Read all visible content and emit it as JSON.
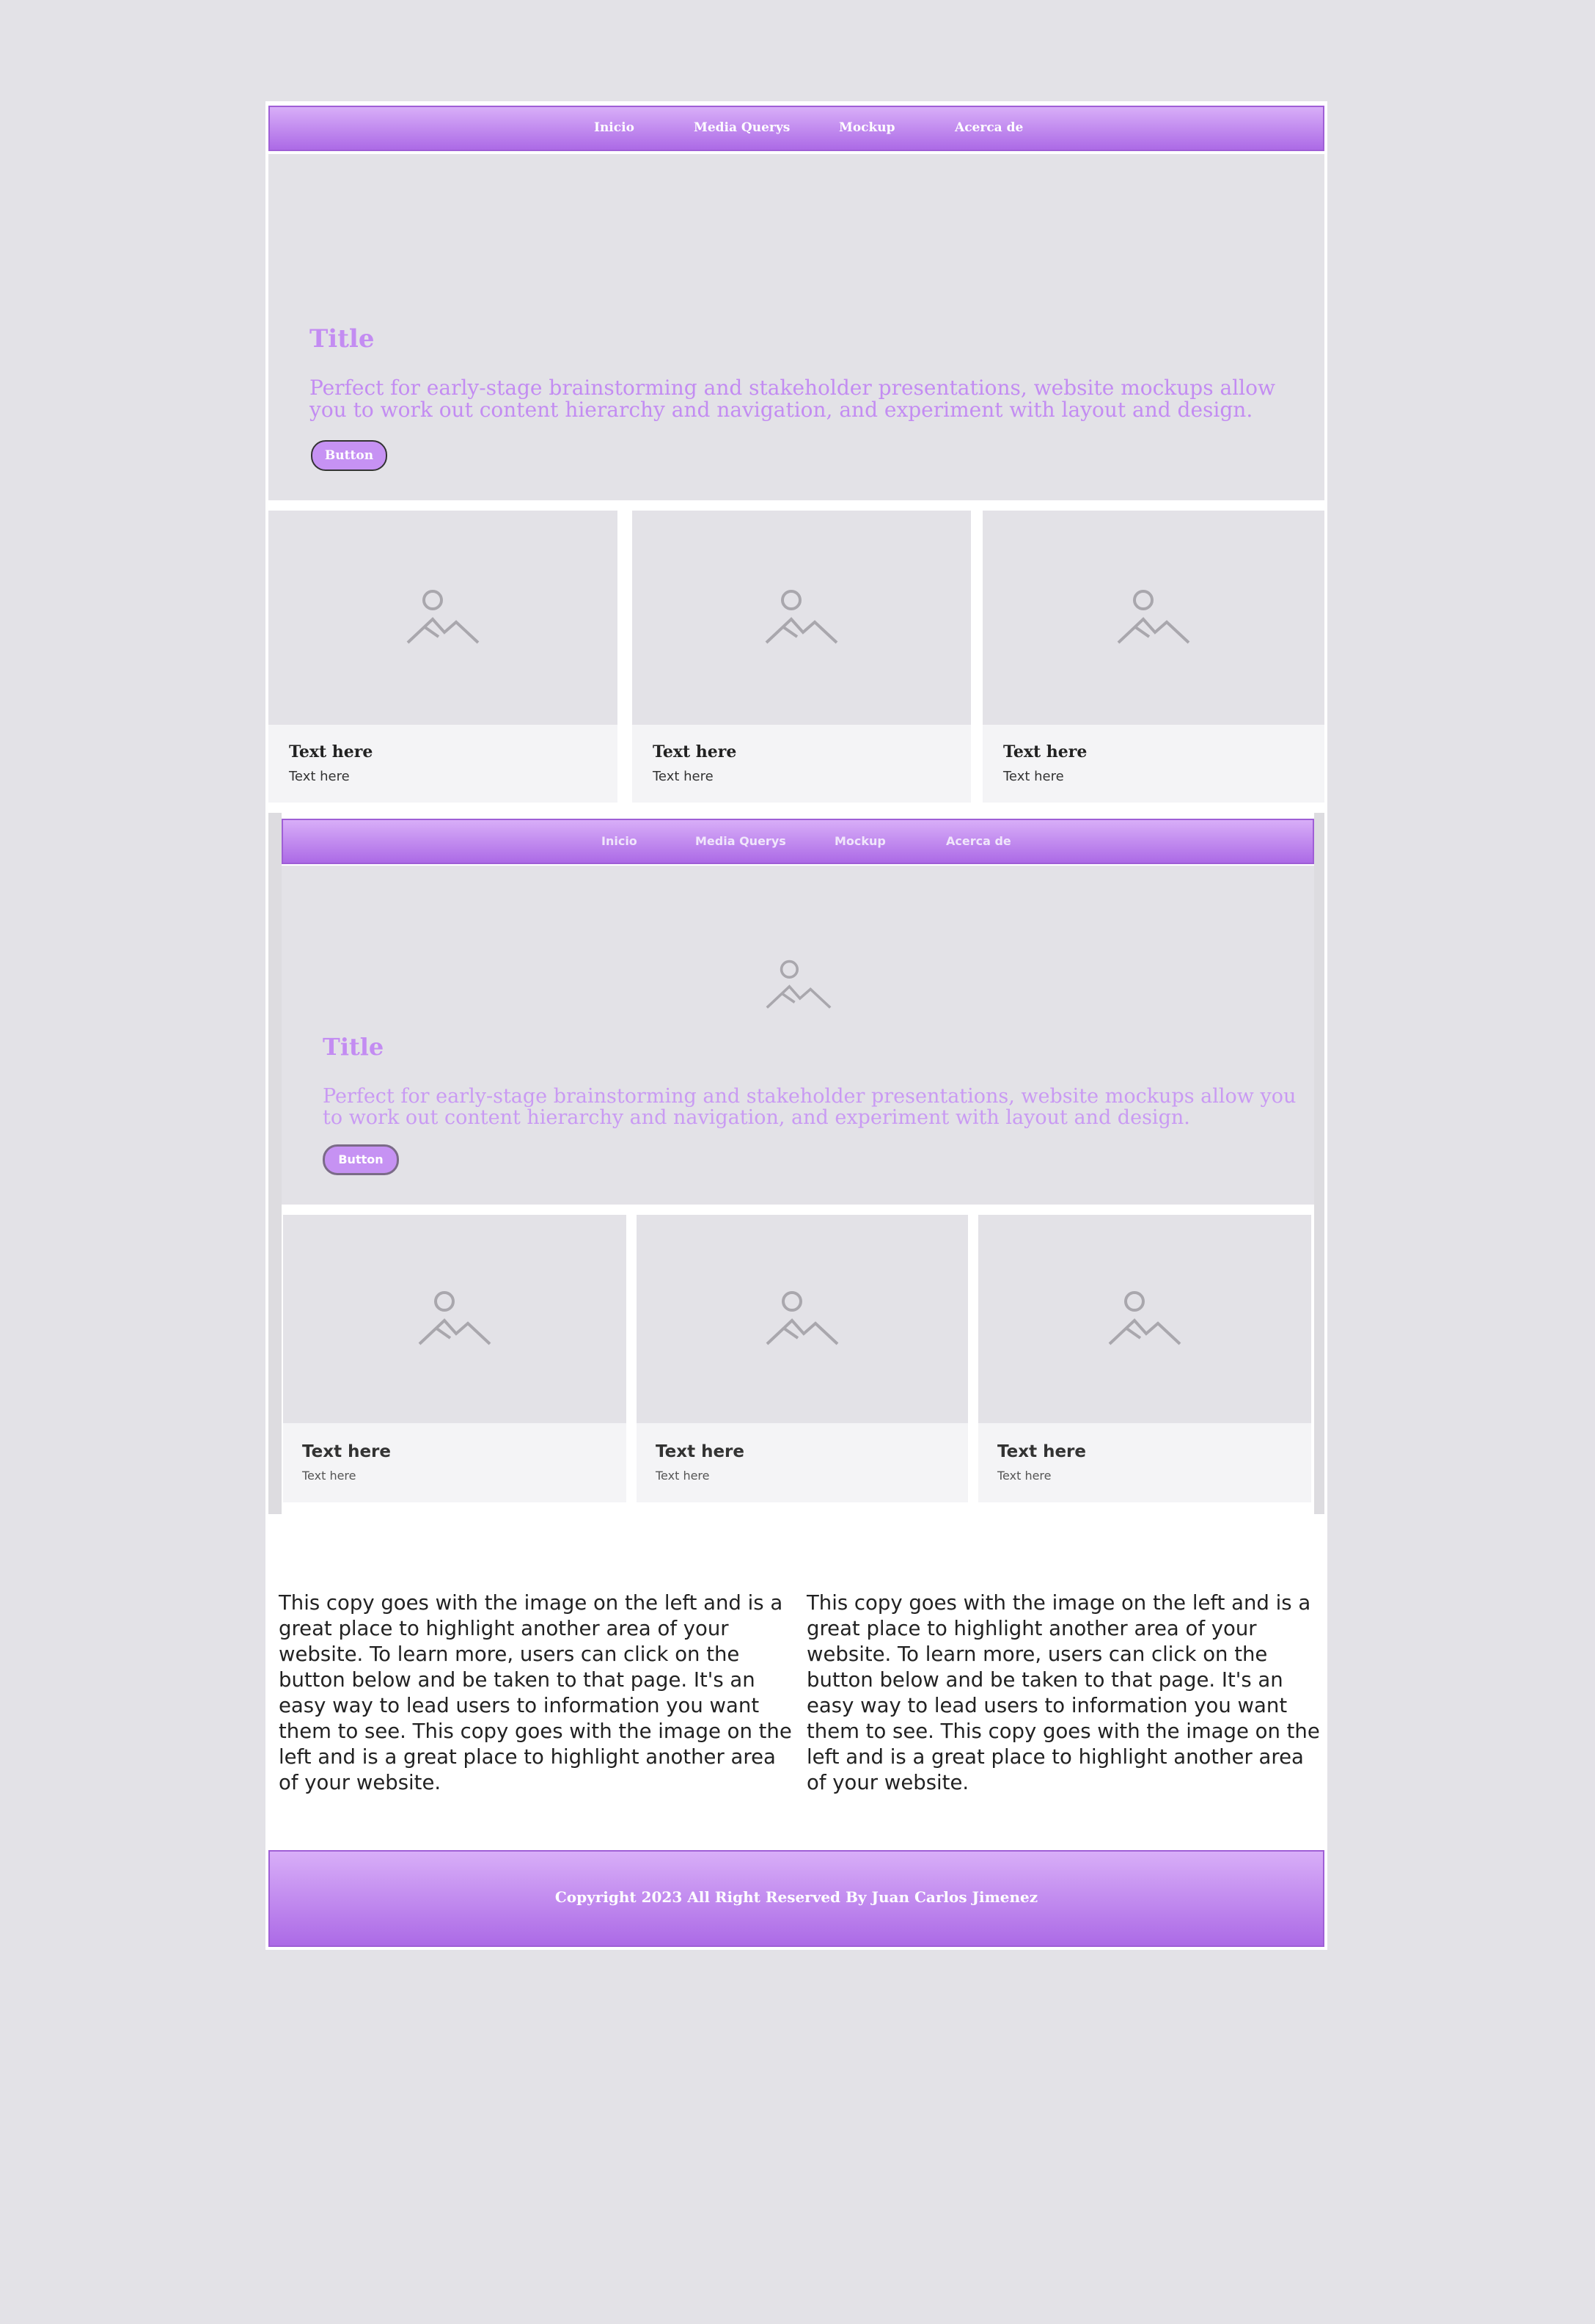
{
  "nav": {
    "items": [
      "Inicio",
      "Media Querys",
      "Mockup",
      "Acerca de"
    ]
  },
  "hero": {
    "title": "Title",
    "text": "Perfect for early-stage brainstorming and stakeholder presentations, website mockups allow you to work out content hierarchy and navigation, and experiment with layout and design.",
    "button_label": "Button"
  },
  "cards": [
    {
      "heading": "Text here",
      "subtext": "Text here"
    },
    {
      "heading": "Text here",
      "subtext": "Text here"
    },
    {
      "heading": "Text here",
      "subtext": "Text here"
    }
  ],
  "embedded_preview": {
    "nav": {
      "items": [
        "Inicio",
        "Media Querys",
        "Mockup",
        "Acerca de"
      ]
    },
    "hero": {
      "title": "Title",
      "text": "Perfect for early-stage brainstorming and stakeholder presentations, website mockups allow you to work out content hierarchy and navigation, and experiment with layout and design.",
      "button_label": "Button",
      "image_icon": "image-placeholder-icon"
    },
    "cards": [
      {
        "heading": "Text here",
        "subtext": "Text here"
      },
      {
        "heading": "Text here",
        "subtext": "Text here"
      },
      {
        "heading": "Text here",
        "subtext": "Text here"
      }
    ]
  },
  "copy_blocks": [
    "This copy goes with the image on the left and is a great place to highlight another area of your website. To learn more, users can click on the button below and be taken to that page. It's an easy way to lead users to information you want them to see. This copy goes with the image on the left and is a great place to highlight another area of your website.",
    "This copy goes with the image on the left and is a great place to highlight another area of your website. To learn more, users can click on the button below and be taken to that page. It's an easy way to lead users to information you want them to see. This copy goes with the image on the left and is a great place to highlight another area of your website."
  ],
  "footer": {
    "text": "Copyright 2023 All Right Reserved By Juan Carlos Jimenez"
  },
  "colors": {
    "page_background": "#e3e2e7",
    "accent_purple": "#c38cf2",
    "bar_gradient_top": "#d8aef8",
    "bar_gradient_bottom": "#ac6ae6"
  }
}
